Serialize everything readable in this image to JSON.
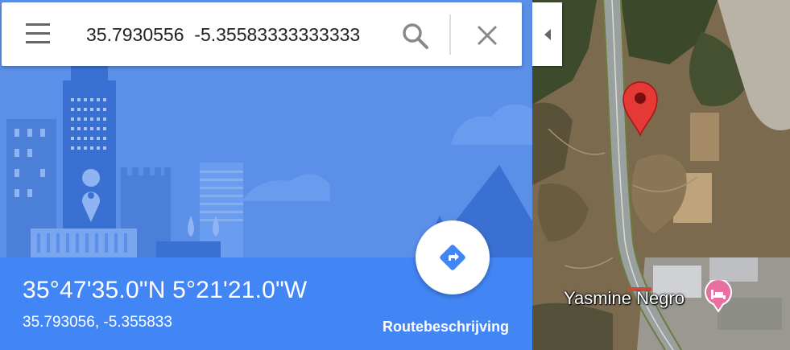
{
  "search": {
    "query": "35.7930556  -5.35583333333333"
  },
  "place": {
    "coords_dms": "35°47'35.0\"N 5°21'21.0\"W",
    "coords_decimal": "35.793056, -5.355833"
  },
  "actions": {
    "directions_label": "Routebeschrijving"
  },
  "map": {
    "poi_name": "Yasmine Negro"
  },
  "icons": {
    "menu": "menu-icon",
    "search": "search-icon",
    "close": "close-icon",
    "directions": "directions-icon",
    "collapse": "chevron-left-icon",
    "pin": "map-pin-icon",
    "poi": "hotel-icon"
  },
  "colors": {
    "accent": "#4285f4",
    "pin": "#e53935",
    "poi": "#e86fa0"
  }
}
